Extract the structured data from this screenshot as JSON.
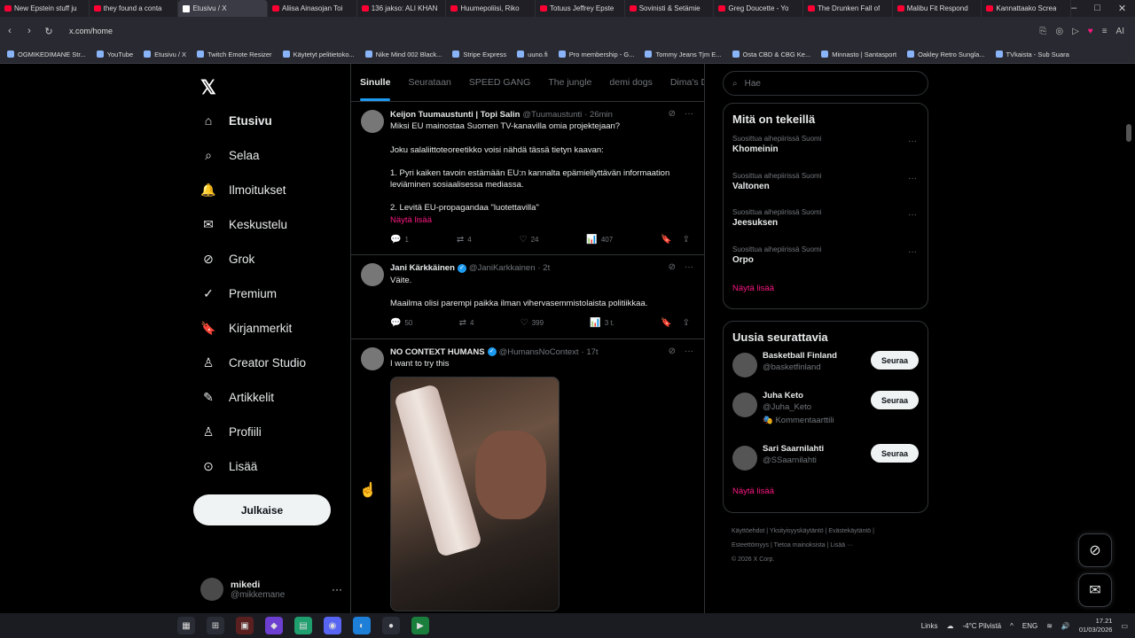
{
  "browser": {
    "tabs": [
      {
        "label": "New Epstein stuff ju",
        "fav": "youtube"
      },
      {
        "label": "they found a conta",
        "fav": "youtube"
      },
      {
        "label": "Etusivu / X",
        "fav": "x",
        "active": true
      },
      {
        "label": "Aliisa Ainasojan Toi",
        "fav": "youtube"
      },
      {
        "label": "136 jakso: ALI KHAN",
        "fav": "youtube"
      },
      {
        "label": "Huumepoliisi, Riko",
        "fav": "youtube"
      },
      {
        "label": "Totuus Jeffrey Epste",
        "fav": "youtube"
      },
      {
        "label": "Sovinisti & Setämie",
        "fav": "youtube"
      },
      {
        "label": "Greg Doucette - Yo",
        "fav": "youtube"
      },
      {
        "label": "The Drunken Fall of",
        "fav": "youtube"
      },
      {
        "label": "Malibu Fit Respond",
        "fav": "youtube"
      },
      {
        "label": "Kannattaako Screa",
        "fav": "youtube"
      }
    ],
    "url": "x.com/home",
    "bookmarks": [
      "OGMIKEDIMANE Str...",
      "YouTube",
      "Etusivu / X",
      "Twitch Emote Resizer",
      "Käytetyt pelitietoko...",
      "Nike Mind 002 Black...",
      "Stripe Express",
      "uuno.fi",
      "Pro membership - G...",
      "Tommy Jeans Tjm E...",
      "Osta CBD & CBG Ke...",
      "Minnasto | Santasport",
      "Oakley Retro Sungla...",
      "TVkaista - Sub Suara"
    ]
  },
  "nav": {
    "items": [
      {
        "label": "Etusivu",
        "icon": "home-icon",
        "glyph": "⌂"
      },
      {
        "label": "Selaa",
        "icon": "search-icon",
        "glyph": "⌕"
      },
      {
        "label": "Ilmoitukset",
        "icon": "bell-icon",
        "glyph": "🔔"
      },
      {
        "label": "Keskustelu",
        "icon": "mail-icon",
        "glyph": "✉"
      },
      {
        "label": "Grok",
        "icon": "grok-icon",
        "glyph": "⊘"
      },
      {
        "label": "Premium",
        "icon": "premium-icon",
        "glyph": "✓"
      },
      {
        "label": "Kirjanmerkit",
        "icon": "bookmark-icon",
        "glyph": "🔖"
      },
      {
        "label": "Creator Studio",
        "icon": "creator-icon",
        "glyph": "♙"
      },
      {
        "label": "Artikkelit",
        "icon": "article-icon",
        "glyph": "✎"
      },
      {
        "label": "Profiili",
        "icon": "profile-icon",
        "glyph": "♙"
      },
      {
        "label": "Lisää",
        "icon": "more-icon",
        "glyph": "⊙"
      }
    ],
    "post_button": "Julkaise",
    "account": {
      "name": "mikedi",
      "handle": "@mikkemane"
    }
  },
  "timeline": {
    "tabs": [
      "Sinulle",
      "Seurataan",
      "SPEED GANG",
      "The jungle",
      "demi dogs",
      "Dima's Dist"
    ],
    "tweets": [
      {
        "name": "Keijon Tuumaustunti | Topi Salin",
        "handle": "@Tuumaustunti",
        "time": "· 26min",
        "verified": false,
        "lines": [
          "Miksi EU mainostaa Suomen TV-kanavilla omia projektejaan?",
          "",
          "Joku salaliittoteoreetikko voisi nähdä tässä tietyn kaavan:",
          "",
          "1. Pyri kaiken tavoin estämään EU:n kannalta epämiellyttävän informaation leviäminen sosiaalisessa mediassa.",
          "",
          "2. Levitä EU-propagandaa \"luotettavilla\""
        ],
        "show_more": "Näytä lisää",
        "replies": "1",
        "reposts": "4",
        "likes": "24",
        "views": "407"
      },
      {
        "name": "Jani Kärkkäinen",
        "handle": "@JaniKarkkainen",
        "time": "· 2t",
        "verified": true,
        "lines": [
          "Väite.",
          "",
          "Maailma olisi parempi paikka ilman vihervasemmistolaista politiikkaa."
        ],
        "show_more": "",
        "replies": "50",
        "reposts": "4",
        "likes": "399",
        "views": "3 t."
      },
      {
        "name": "NO CONTEXT HUMANS",
        "handle": "@HumansNoContext",
        "time": "· 17t",
        "verified": true,
        "lines": [
          "I want to try this"
        ],
        "show_more": ""
      }
    ]
  },
  "sidebar": {
    "search_placeholder": "Hae",
    "trends_title": "Mitä on tekeillä",
    "trends": [
      {
        "meta": "Suosittua aihepiirissä Suomi",
        "name": "Khomeinin"
      },
      {
        "meta": "Suosittua aihepiirissä Suomi",
        "name": "Valtonen"
      },
      {
        "meta": "Suosittua aihepiirissä Suomi",
        "name": "Jeesuksen"
      },
      {
        "meta": "Suosittua aihepiirissä Suomi",
        "name": "Orpo"
      }
    ],
    "trends_more": "Näytä lisää",
    "follow_title": "Uusia seurattavia",
    "follow": [
      {
        "name": "Basketball Finland",
        "handle": "@basketfinland",
        "sub": "",
        "button": "Seuraa"
      },
      {
        "name": "Juha Keto",
        "handle": "@Juha_Keto",
        "sub": "🎭 Kommentaarttili",
        "button": "Seuraa"
      },
      {
        "name": "Sari Saarnilahti",
        "handle": "@SSaarnilahti",
        "sub": "",
        "button": "Seuraa"
      }
    ],
    "follow_more": "Näytä lisää",
    "footer": {
      "line1": "Käyttöehdot | Yksityisyyskäytäntö | Evästekäytäntö |",
      "line2": "Esteettömyys | Tietoa mainoksista | Lisää ···",
      "line3": "© 2026 X Corp."
    }
  },
  "taskbar": {
    "links": "Links",
    "weather": "-4°C Pilvistä",
    "lang": "ENG",
    "time": "17.21",
    "date": "01/03/2026"
  },
  "colors": {
    "accent": "#1d9bf0",
    "link": "#f91880",
    "background": "#000000"
  }
}
